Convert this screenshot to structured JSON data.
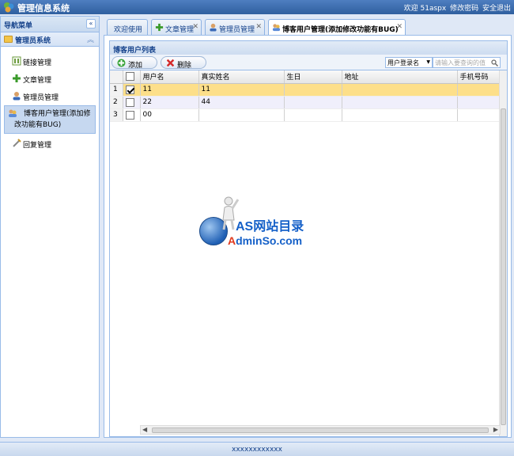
{
  "header": {
    "title": "管理信息系统",
    "welcome": "欢迎 51aspx",
    "change_password": "修改密码",
    "logout": "安全退出",
    "logo_icon": "system-logo-icon"
  },
  "sidebar": {
    "title": "导航菜单",
    "group": "管理员系统",
    "items": [
      {
        "label": "链接管理",
        "icon": "link-icon"
      },
      {
        "label": "文章管理",
        "icon": "plus-icon"
      },
      {
        "label": "管理员管理",
        "icon": "user-icon"
      },
      {
        "label": "博客用户管理(添加修改功能有BUG)",
        "icon": "users-icon",
        "active": true
      },
      {
        "label": "回复管理",
        "icon": "reply-icon"
      }
    ]
  },
  "tabs": [
    {
      "label": "欢迎使用",
      "closable": false
    },
    {
      "label": "文章管理",
      "closable": true
    },
    {
      "label": "管理员管理",
      "closable": true
    },
    {
      "label": "博客用户管理(添加修改功能有BUG)",
      "closable": true,
      "active": true
    }
  ],
  "grid": {
    "title": "博客用户列表",
    "add_label": "添加",
    "delete_label": "删除",
    "search_field": "用户登录名",
    "search_placeholder": "请输入要查询的值",
    "columns": [
      "用户名",
      "真实姓名",
      "生日",
      "地址",
      "手机号码"
    ],
    "rows": [
      {
        "num": "1",
        "checked": true,
        "cells": [
          "11",
          "11",
          "",
          "",
          ""
        ]
      },
      {
        "num": "2",
        "checked": false,
        "cells": [
          "22",
          "44",
          "",
          "",
          ""
        ]
      },
      {
        "num": "3",
        "checked": false,
        "cells": [
          "00",
          "",
          "",
          "",
          ""
        ]
      }
    ]
  },
  "watermark": {
    "line1": "AS网站目录",
    "line2_a": "A",
    "line2_b": "dminSo.com"
  },
  "footer": {
    "text": "xxxxxxxxxxxx"
  },
  "colors": {
    "accent": "#15428b",
    "selected_row": "#fddf8a",
    "header_bg": "#2f5f9f"
  }
}
